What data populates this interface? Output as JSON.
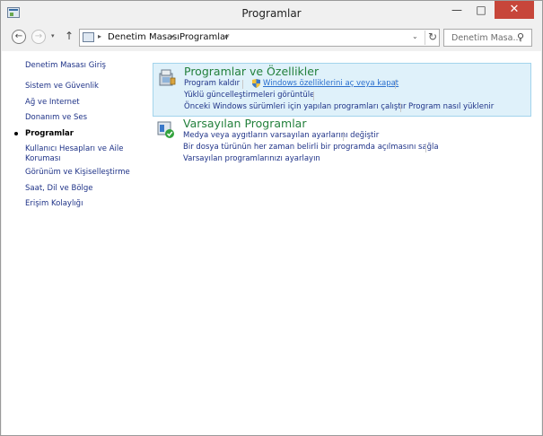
{
  "window": {
    "title": "Programlar",
    "min_label": "—",
    "max_label": "□",
    "close_label": "✕"
  },
  "nav": {
    "back_glyph": "←",
    "forward_glyph": "→",
    "recent_glyph": "▾",
    "up_glyph": "↑",
    "breadcrumb": [
      "Denetim Masası",
      "Programlar"
    ],
    "separator": "▸",
    "dropdown_glyph": "⌄",
    "refresh_glyph": "↻"
  },
  "search": {
    "placeholder": "Denetim Masa...",
    "icon_glyph": "⚲"
  },
  "sidebar": {
    "items": [
      {
        "label": "Denetim Masası Giriş"
      },
      {
        "label": "Sistem ve Güvenlik"
      },
      {
        "label": "Ağ ve Internet"
      },
      {
        "label": "Donanım ve Ses"
      },
      {
        "label": "Programlar",
        "active": true
      },
      {
        "label": "Kullanıcı Hesapları ve Aile Koruması"
      },
      {
        "label": "Görünüm ve Kişiselleştirme"
      },
      {
        "label": "Saat, Dil ve Bölge"
      },
      {
        "label": "Erişim Kolaylığı"
      }
    ]
  },
  "categories": [
    {
      "title": "Programlar ve Özellikler",
      "icon": "programs-features-icon",
      "links": [
        "Program kaldır",
        "Windows özelliklerini aç veya kapat",
        "Yüklü güncelleştirmeleri görüntüle",
        "Önceki Windows sürümleri için yapılan programları çalıştır",
        "Program nasıl yüklenir"
      ]
    },
    {
      "title": "Varsayılan Programlar",
      "icon": "default-programs-icon",
      "links": [
        "Medya veya aygıtların varsayılan ayarlarını değiştir",
        "Bir dosya türünün her zaman belirli bir programda açılmasını sağla",
        "Varsayılan programlarınızı ayarlayın"
      ]
    }
  ],
  "colors": {
    "link": "#1e3287",
    "category_title": "#23803c",
    "hover_background": "#dff1fa",
    "close_button": "#c7463a"
  }
}
